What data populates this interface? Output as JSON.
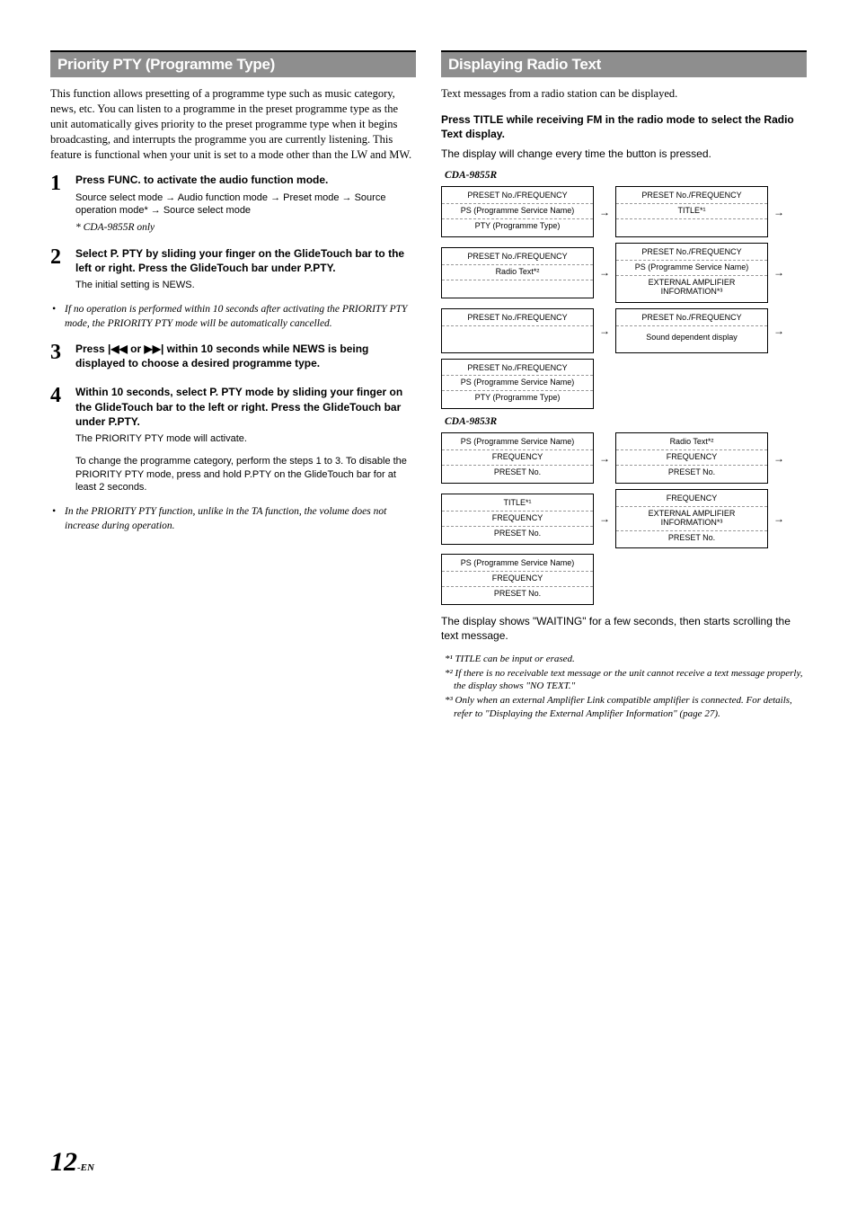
{
  "left": {
    "heading": "Priority PTY (Programme Type)",
    "intro": "This function allows presetting of a programme type such as music category, news, etc. You can listen to a programme in the preset programme type as the unit automatically gives priority to the preset programme type when it begins broadcasting, and interrupts the programme you are currently listening. This feature is functional when your unit is set to a mode other than the LW and MW.",
    "step1": {
      "num": "1",
      "title_pre": "Press ",
      "title_bold": "FUNC.",
      "title_post": " to activate the audio function mode.",
      "sub": "Source select mode → Audio function mode → Preset mode → Source operation mode* → Source select mode",
      "note": "* CDA-9855R only"
    },
    "bullet1": "If no operation is performed within 10 seconds after activating the PRIORITY PTY mode, the  PRIORITY PTY mode will be automatically cancelled.",
    "step2": {
      "num": "2",
      "pre1": "Select P. PTY by sliding your finger on the ",
      "b1": "GlideTouch bar",
      "mid1": " to the left or right. Press the ",
      "b2": "GlideTouch bar",
      "post1": " under P.PTY.",
      "sub": "The initial setting is NEWS."
    },
    "step3": {
      "num": "3",
      "pre": "Press ",
      "icons": "|◀◀ or ▶▶|",
      "post": " within 10 seconds while NEWS is being displayed to choose a desired programme type."
    },
    "step4": {
      "num": "4",
      "pre": "Within 10 seconds, select P. PTY mode by sliding your finger on the ",
      "b1": "GlideTouch bar",
      "mid": " to the left or right. Press the ",
      "b2": "GlideTouch bar",
      "post": " under P.PTY.",
      "sub1": "The PRIORITY PTY mode will activate.",
      "sub2": "To change the programme category, perform the steps 1 to 3. To disable the PRIORITY PTY mode, press and hold P.PTY on the GlideTouch bar for at least 2 seconds."
    },
    "bullet2": "In the PRIORITY PTY function, unlike in the TA function, the volume does not increase during operation."
  },
  "right": {
    "heading": "Displaying Radio Text",
    "intro": "Text messages from a radio station can be displayed.",
    "sub_pre": "Press ",
    "sub_bold": "TITLE",
    "sub_post": " while receiving FM in the radio mode to select the Radio Text display.",
    "plain1": "The display will change every time the button is pressed.",
    "model1": "CDA-9855R",
    "model2": "CDA-9853R",
    "labels": {
      "preset_freq": "PRESET No./FREQUENCY",
      "ps_name": "PS (Programme Service Name)",
      "pty": "PTY (Programme Type)",
      "title": "TITLE*¹",
      "radio_text": "Radio Text*²",
      "ext_amp": "EXTERNAL AMPLIFIER INFORMATION*³",
      "sound_dep": "Sound dependent display",
      "freq": "FREQUENCY",
      "preset_no": "PRESET No."
    },
    "post_text": "The display shows \"WAITING\" for a few seconds, then starts scrolling the text message.",
    "fn1": "*¹ TITLE can be input or erased.",
    "fn2": "*² If there is no receivable text message or the unit cannot receive a text message properly, the display shows \"NO TEXT.\"",
    "fn3": "*³ Only when an external Amplifier Link compatible amplifier is connected. For details, refer to \"Displaying the External Amplifier Information\" (page 27)."
  },
  "page": {
    "big": "12",
    "small": "-EN"
  }
}
